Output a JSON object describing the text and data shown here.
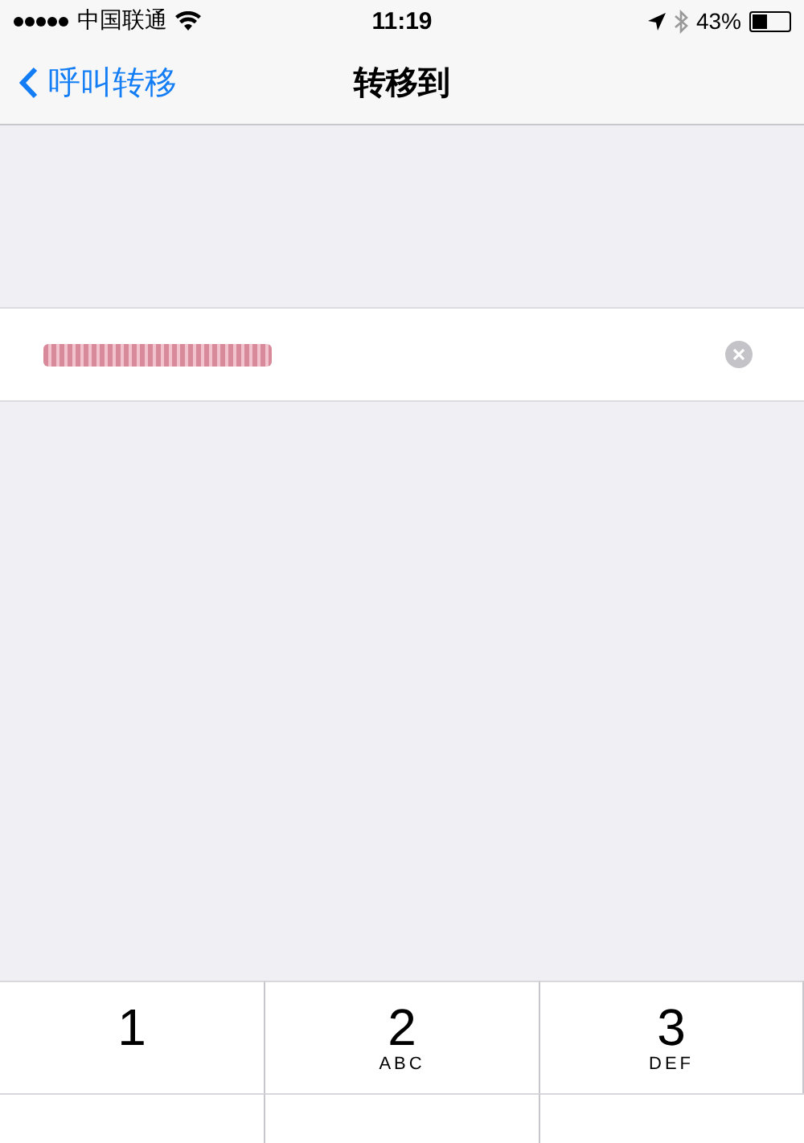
{
  "status_bar": {
    "carrier": "中国联通",
    "time": "11:19",
    "battery_text": "43%",
    "battery": {
      "level": 0.43
    }
  },
  "nav_bar": {
    "back_label": "呼叫转移",
    "title": "转移到"
  },
  "field": {
    "value_redacted": true
  },
  "keypad": [
    {
      "digit": "1"
    },
    {
      "digit": "2",
      "letters": "ABC"
    },
    {
      "digit": "3",
      "letters": "DEF"
    }
  ]
}
